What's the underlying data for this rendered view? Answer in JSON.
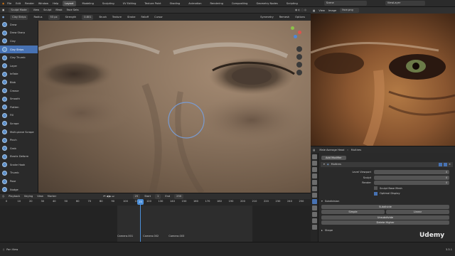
{
  "topbar": {
    "menus": [
      "File",
      "Edit",
      "Render",
      "Window",
      "Help"
    ],
    "tabs": [
      "Layout",
      "Modeling",
      "Sculpting",
      "UV Editing",
      "Texture Paint",
      "Shading",
      "Animation",
      "Rendering",
      "Compositing",
      "Geometry Nodes",
      "Scripting"
    ],
    "active_tab": "Layout",
    "scene": "Scene",
    "view_layer": "ViewLayer"
  },
  "viewport_header": {
    "mode": "Sculpt Mode",
    "items": [
      "View",
      "Sculpt",
      "Mask",
      "Face Sets"
    ]
  },
  "tool_header": {
    "brush": "Clay Strips",
    "radius_label": "Radius",
    "radius_value": "53 px",
    "strength_label": "Strength",
    "strength_value": "0.801",
    "items": [
      "Brush",
      "Texture",
      "Stroke",
      "Falloff",
      "Cursor"
    ],
    "right_items": [
      "Symmetry",
      "Remesh",
      "Options"
    ]
  },
  "toolbar": {
    "tools": [
      "Draw",
      "Draw Sharp",
      "Clay",
      "Clay Strips",
      "Clay Thumb",
      "Layer",
      "Inflate",
      "Blob",
      "Crease",
      "Smooth",
      "Flatten",
      "Fill",
      "Scrape",
      "Multi-plane Scrape",
      "Pinch",
      "Grab",
      "Elastic Deform",
      "Snake Hook",
      "Thumb",
      "Pose",
      "Nudge",
      "Rotate"
    ],
    "active": "Clay Strips"
  },
  "ref_header": {
    "items": [
      "View",
      "Image"
    ],
    "image_name": "face.png"
  },
  "timeline": {
    "items": [
      "Playback",
      "Keying",
      "View",
      "Marker"
    ],
    "frame": "25",
    "start": "1",
    "end": "250",
    "ticks": [
      "0",
      "10",
      "20",
      "30",
      "40",
      "50",
      "60",
      "70",
      "80",
      "90",
      "100",
      "110",
      "120",
      "130",
      "140",
      "150",
      "160",
      "170",
      "180",
      "190",
      "200",
      "210",
      "220",
      "230",
      "240",
      "250"
    ],
    "cameras": [
      "Camera.001",
      "Camera.002",
      "Camera.003"
    ]
  },
  "properties": {
    "object": "Male Average Head",
    "modifier_tab": "Multires",
    "add_modifier": "Add Modifier",
    "modifier_name": "Multires",
    "levels": [
      {
        "label": "Level Viewport",
        "value": "4"
      },
      {
        "label": "Sculpt",
        "value": "4"
      },
      {
        "label": "Render",
        "value": "4"
      }
    ],
    "checkboxes": [
      "Sculpt Base Mesh",
      "Optimal Display"
    ],
    "subdivision_label": "Subdivision",
    "buttons": [
      "Subdivide",
      "Simple",
      "Linear",
      "Unsubdivide",
      "Delete Higher"
    ],
    "shape_label": "Shape"
  },
  "statusbar": {
    "left": "Pan View",
    "right": "3.3.1"
  },
  "watermark": "Udemy",
  "colors": {
    "accent": "#4772b3",
    "playhead": "#4b8ed8"
  }
}
